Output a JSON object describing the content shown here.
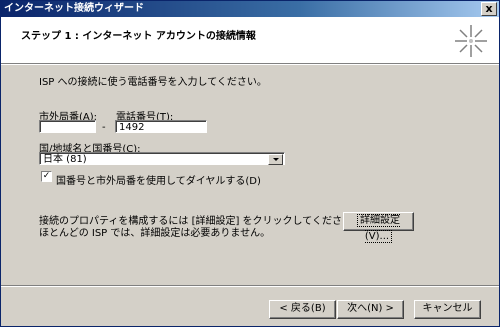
{
  "window": {
    "title": "インターネット接続ウィザード",
    "close_label": "x"
  },
  "header": {
    "title": "ステップ 1 : インターネット アカウントの接続情報",
    "icon": "wizard-sparkle-icon"
  },
  "form": {
    "intro": "ISP への接続に使う電話番号を入力してください。",
    "area_code_label": "市外局番(A):",
    "area_code_value": "",
    "dash": "-",
    "phone_label": "電話番号(T):",
    "phone_value": "1492",
    "country_label": "国/地域名と国番号(C):",
    "country_selected": "日本 (81)",
    "use_codes_label": "国番号と市外局番を使用してダイヤルする(D)",
    "use_codes_checked": true,
    "advanced_desc_1": "接続のプロパティを構成するには [詳細設定] をクリックしてください。",
    "advanced_desc_2": "ほとんどの ISP では、詳細設定は必要ありません。",
    "advanced_button": "詳細設定(V)..."
  },
  "footer": {
    "back": "< 戻る(B)",
    "next": "次へ(N) >",
    "cancel": "キャンセル"
  }
}
